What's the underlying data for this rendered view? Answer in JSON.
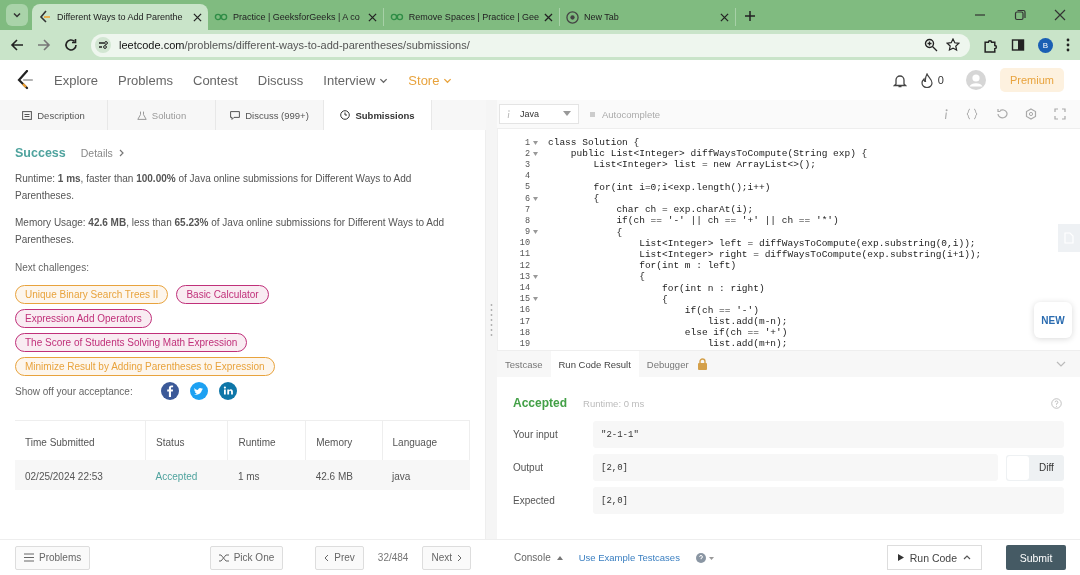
{
  "browser": {
    "tabs": [
      {
        "title": "Different Ways to Add Parenthe",
        "selected": true,
        "kind": "logo"
      },
      {
        "title": "Practice | GeeksforGeeks | A co",
        "selected": false,
        "kind": "glasses"
      },
      {
        "title": "Remove Spaces | Practice | Gee",
        "selected": false,
        "kind": "glasses"
      },
      {
        "title": "New Tab",
        "selected": false,
        "kind": "globe"
      }
    ],
    "url_host": "leetcode.com",
    "url_path": "/problems/different-ways-to-add-parentheses/submissions/",
    "profile": "B"
  },
  "nav": {
    "items": [
      {
        "label": "Explore",
        "menu": false,
        "highlight": false
      },
      {
        "label": "Problems",
        "menu": false,
        "highlight": false
      },
      {
        "label": "Contest",
        "menu": false,
        "highlight": false
      },
      {
        "label": "Discuss",
        "menu": false,
        "highlight": false
      },
      {
        "label": "Interview",
        "menu": true,
        "highlight": false
      },
      {
        "label": "Store",
        "menu": true,
        "highlight": true
      }
    ],
    "streak": "0",
    "premium": "Premium"
  },
  "panel_tabs": [
    {
      "label": "Description",
      "selected": false,
      "disabled": false
    },
    {
      "label": "Solution",
      "selected": false,
      "disabled": true
    },
    {
      "label": "Discuss (999+)",
      "selected": false,
      "disabled": false
    },
    {
      "label": "Submissions",
      "selected": true,
      "disabled": false
    }
  ],
  "submission": {
    "status": "Success",
    "details": "Details",
    "runtime": "Runtime: **1 ms**, faster than **100.00%** of Java online submissions for Different Ways to Add Parentheses.",
    "memory": "Memory Usage: **42.6 MB**, less than **65.23%** of Java online submissions for Different Ways to Add Parentheses.",
    "next_label": "Next challenges:",
    "challenges": [
      {
        "title": "Unique Binary Search Trees II",
        "color": "#e8a33d"
      },
      {
        "title": "Basic Calculator",
        "color": "#c0307a"
      },
      {
        "title": "Expression Add Operators",
        "color": "#c0307a"
      },
      {
        "title": "The Score of Students Solving Math Expression",
        "color": "#c0307a"
      },
      {
        "title": "Minimize Result by Adding Parentheses to Expression",
        "color": "#e8a33d"
      }
    ],
    "share_label": "Show off your acceptance:",
    "table": {
      "columns": [
        "Time Submitted",
        "Status",
        "Runtime",
        "Memory",
        "Language"
      ],
      "rows": [
        {
          "time": "02/25/2024 22:53",
          "status": "Accepted",
          "runtime": "1 ms",
          "memory": "42.6 MB",
          "language": "java"
        }
      ]
    }
  },
  "editor": {
    "language": "Java",
    "autocomplete": {
      "label": "Autocomplete",
      "on": false
    },
    "lines": [
      {
        "n": "1",
        "fold": true,
        "text": "class Solution {"
      },
      {
        "n": "2",
        "fold": true,
        "text": "    public List<Integer> diffWaysToCompute(String exp) {"
      },
      {
        "n": "3",
        "fold": false,
        "text": "        List<Integer> list = new ArrayList<>();"
      },
      {
        "n": "4",
        "fold": false
      },
      {
        "n": "5",
        "fold": false,
        "text": "        for(int i=0;i<exp.length();i++)"
      },
      {
        "n": "6",
        "fold": true,
        "text": "        {"
      },
      {
        "n": "7",
        "fold": false,
        "text": "            char ch = exp.charAt(i);"
      },
      {
        "n": "8",
        "fold": false,
        "text": "            if(ch == '-' || ch == '+' || ch == '*')"
      },
      {
        "n": "9",
        "fold": true,
        "text": "            {"
      },
      {
        "n": "10",
        "fold": false,
        "text": "                List<Integer> left = diffWaysToCompute(exp.substring(0,i));"
      },
      {
        "n": "11",
        "fold": false,
        "text": "                List<Integer> right = diffWaysToCompute(exp.substring(i+1));"
      },
      {
        "n": "12",
        "fold": false,
        "text": "                for(int m : left)"
      },
      {
        "n": "13",
        "fold": true,
        "text": "                {"
      },
      {
        "n": "14",
        "fold": false,
        "text": "                    for(int n : right)"
      },
      {
        "n": "15",
        "fold": true,
        "text": "                    {"
      },
      {
        "n": "16",
        "fold": false,
        "text": "                        if(ch == '-')"
      },
      {
        "n": "17",
        "fold": false,
        "text": "                            list.add(m-n);"
      },
      {
        "n": "18",
        "fold": false,
        "text": "                        else if(ch == '+')"
      },
      {
        "n": "19",
        "fold": false,
        "text": "                            list.add(m+n);"
      }
    ],
    "new_badge": "NEW"
  },
  "result_tabs": [
    {
      "label": "Testcase",
      "selected": false,
      "locked": false
    },
    {
      "label": "Run Code Result",
      "selected": true,
      "locked": false
    },
    {
      "label": "Debugger",
      "selected": false,
      "locked": true
    }
  ],
  "result": {
    "status": "Accepted",
    "runtime": "Runtime: 0 ms",
    "rows": [
      {
        "label": "Your input",
        "value": "\"2-1-1\""
      },
      {
        "label": "Output",
        "value": "[2,0]"
      },
      {
        "label": "Expected",
        "value": "[2,0]"
      }
    ],
    "diff": {
      "label": "Diff",
      "on": false
    }
  },
  "footer": {
    "problems": "Problems",
    "pick": "Pick One",
    "prev": "Prev",
    "position": "32/484",
    "next": "Next",
    "console": "Console",
    "examples": "Use Example Testcases",
    "run": "Run Code",
    "submit": "Submit"
  }
}
